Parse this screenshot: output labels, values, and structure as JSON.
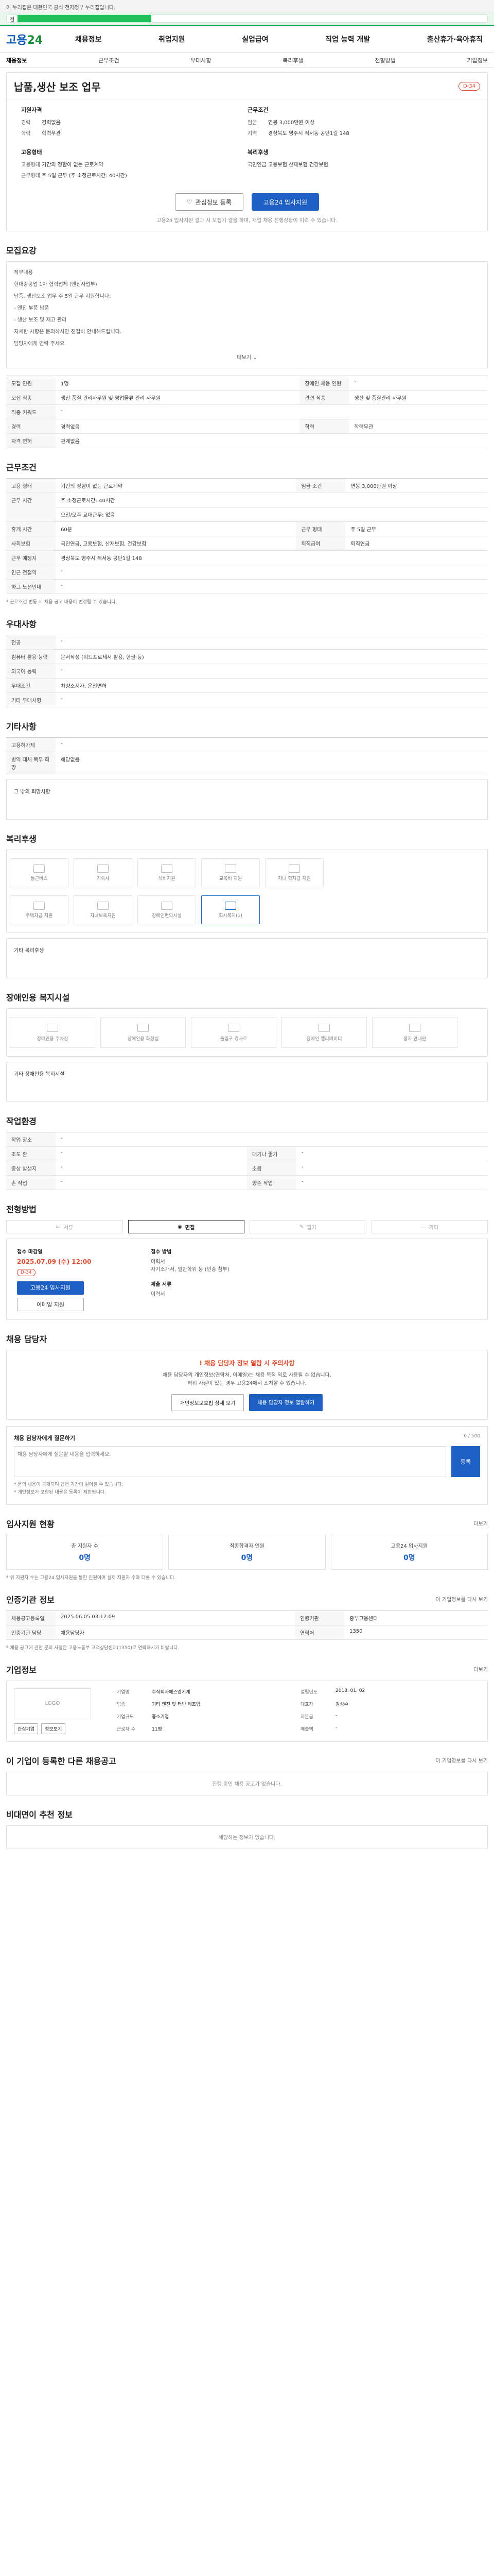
{
  "gov_banner": "이 누리집은 대한민국 공식 전자정부 누리집입니다.",
  "search": {
    "prefix": "검"
  },
  "header": {
    "logo_main": "고용",
    "logo_sub": "24",
    "nav": [
      "채용정보",
      "취업지원",
      "실업급여",
      "직업 능력 개발",
      "출산휴가·육아휴직"
    ]
  },
  "subnav": [
    "채용정보",
    "근무조건",
    "우대사항",
    "복리후생",
    "전형방법",
    "기업정보"
  ],
  "job": {
    "title": "납품,생산 보조 업무",
    "dday": "D-34",
    "recruit_heading": "지원자격",
    "recruit": [
      {
        "k": "경력",
        "v": "경력없음"
      },
      {
        "k": "학력",
        "v": "학력무관"
      }
    ],
    "employ_heading": "고용형태",
    "employ": [
      {
        "k": "고용형태",
        "v": "기간의 정함이 없는 근로계약"
      },
      {
        "k": "근무형태",
        "v": "주 5일 근무 (주 소정근로시간: 40시간)"
      }
    ],
    "cond_heading": "근무조건",
    "cond": [
      {
        "k": "임금",
        "v": "연봉 3,000만원 이상"
      },
      {
        "k": "지역",
        "v": "경상북도 영주시 적서동 공단1길 148"
      }
    ],
    "cond2_heading": "복리후생",
    "cond2": [
      {
        "k": "",
        "v": "국민연금 고용보험 산재보험 건강보험"
      }
    ]
  },
  "actions": {
    "scrap": "관심정보 등록",
    "apply": "고용24 입사지원"
  },
  "actions_note": "고용24 입사지원 결과 시 모집기 결을 하며, 개업 채용 진행상황이 이력 수 있습니다.",
  "duty": {
    "title": "모집요강",
    "lines": [
      "직무내용",
      "현대중공업 1차 협력업체 (엔진사업부)",
      "납품, 생산보조 업무 주 5일 근무 지원합니다.",
      "- 엔진 부품 납품",
      "- 생산 보조 및 재고 관리",
      "자세한 사항은 문의하시면 친절히 안내해드립니다.",
      "담당자에게 연락 주세요."
    ],
    "more": "더보기"
  },
  "recruit_table": [
    [
      "모집 인원",
      "1명",
      "장애인 채용 인원",
      "-"
    ],
    [
      "모집 직종",
      "생산 품질 관리사무원 및 영업물류 관리 사무원",
      "관련 직종",
      "생산 및 품질관리 사무원"
    ],
    [
      "직종 키워드",
      "-",
      "",
      ""
    ],
    [
      "경력",
      "경력없음",
      "학력",
      "학력무관"
    ],
    [
      "자격 면허",
      "관계없음",
      "",
      ""
    ]
  ],
  "work": {
    "title": "근무조건",
    "rows": [
      [
        "고용 형태",
        "기간의 정함이 없는 근로계약",
        "임금 조건",
        "연봉 3,000만원 이상"
      ],
      [
        "근무 시간",
        "주 소정근로시간: 40시간",
        "",
        ""
      ],
      [
        "",
        "오전/오후 교대근무: 없음",
        "",
        ""
      ],
      [
        "휴게 시간",
        "60분",
        "근무 형태",
        "주 5일 근무"
      ],
      [
        "사회보험",
        "국민연금, 고용보험, 산재보험, 건강보험",
        "퇴직급여",
        "퇴직연금"
      ],
      [
        "근무 예정지",
        "경상북도 영주시 적서동 공단1길 148",
        "",
        ""
      ],
      [
        "인근 전철역",
        "-",
        "",
        ""
      ],
      [
        "하그 노선안내",
        "-",
        "",
        ""
      ]
    ],
    "footnote": "* 근로조건 변동 시 채용 공고 내용이 변경될 수 있습니다."
  },
  "pref": {
    "title": "우대사항",
    "rows": [
      [
        "전공",
        "-"
      ],
      [
        "컴퓨터 활용 능력",
        "문서작성 (워드프로세서 활용, 한글 등)"
      ],
      [
        "외국어 능력",
        "-"
      ],
      [
        "우대조건",
        "차량소지자, 운전면허"
      ],
      [
        "기타 우대사항",
        "-"
      ]
    ]
  },
  "other": {
    "title": "기타사항",
    "rows": [
      [
        "고용허가제",
        "-"
      ],
      [
        "병역 대체 복무 희망",
        "해당없음"
      ]
    ],
    "note": "그 밖의 희망사항"
  },
  "welfare": {
    "title": "복리후생",
    "items": [
      "통근버스",
      "기숙사",
      "식비지원",
      "교육비 지원",
      "자녀 학자금 지원",
      "주택자금 지원",
      "자녀보육지원",
      "장애인편의시설",
      "회사복지(1)",
      ""
    ],
    "note": "기타 복리후생"
  },
  "facility": {
    "title": "장애인용 복지시설",
    "items": [
      "장애인용 주차장",
      "장애인용 화장실",
      "출입구 경사로",
      "장애인 엘리베이터",
      "점자 안내판"
    ],
    "note": "기타 장애인용 복지시설"
  },
  "process": {
    "title": "작업환경",
    "rows": [
      [
        "작업 장소",
        "-",
        "",
        ""
      ],
      [
        "조도 환",
        "-",
        "대기나 좋기",
        "-"
      ],
      [
        "중상 발생지",
        "-",
        "소음",
        "-"
      ],
      [
        "손 작업",
        "-",
        "양손 작업",
        "-"
      ]
    ]
  },
  "method": {
    "title": "전형방법",
    "items": [
      "서류",
      "면접",
      "필기",
      "기타"
    ],
    "deadline_label": "접수 마감일",
    "deadline": "2025.07.09 (수) 12:00",
    "dday": "D-34",
    "apply_btn": "고용24 입사지원",
    "email_btn": "이메일 지원",
    "docs_label": "접수 방법",
    "docs": [
      "이력서",
      "자기소개서, 일반학위 등 (인증 첨부)"
    ],
    "submit_label": "제출 서류",
    "submit": "이력서"
  },
  "contact": {
    "title": "채용 담당자",
    "warn": "채용 담당자 정보 열람 시 주의사항",
    "lines": [
      "채용 담당자의 개인정보(연락처, 이메일)는 채용 목적 외로 사용될 수 없습니다.",
      "허위 사실이 있는 경우 고용24에서 조치할 수 있습니다."
    ],
    "btn1": "개인정보보호법 상세 보기",
    "btn2": "채용 담당자 정보 열람하기"
  },
  "qa": {
    "title": "채용 담당자에게 질문하기",
    "count": "0 / 500",
    "placeholder": "채용 담당자에게 질문할 내용을 입력하세요.",
    "button": "등록",
    "notes": [
      "* 문의 내용이 공개되며 답변 기간이 길어질 수 있습니다.",
      "* 개인정보가 포함된 내용은 등록이 제한됩니다."
    ]
  },
  "applicant": {
    "title": "입사지원 현황",
    "more": "더보기",
    "stats": [
      {
        "label": "총 지원자 수",
        "value": "0명"
      },
      {
        "label": "최종합격자 인원",
        "value": "0명"
      },
      {
        "label": "고용24 입사지원",
        "value": "0명"
      }
    ],
    "note": "* 위 지원자 수는 고용24 입사지원을 통한 인원이며 실제 지원자 수와 다를 수 있습니다."
  },
  "agency_info": {
    "title": "인증기관 정보",
    "more": "이 기업정보를 다시 보기",
    "rows": [
      [
        "채용공고등록일",
        "2025.06.05 03:12:09",
        "인증기관",
        "중부고용센터"
      ],
      [
        "인증기관 담당",
        "채용담당자",
        "연락처",
        "1350"
      ]
    ],
    "note": "* 채용 공고에 관한 문의 사항은 고용노동부 고객상담센터(1350)로 연락하시기 바랍니다."
  },
  "company": {
    "title": "기업정보",
    "more": "더보기",
    "logo_text": "LOGO",
    "btns": [
      "관심기업",
      "정보보기"
    ],
    "info": [
      [
        "기업명",
        "주식회사에스엠기계"
      ],
      [
        "업종",
        "기타 엔진 및 터빈 제조업"
      ],
      [
        "기업규모",
        "중소기업"
      ],
      [
        "근로자 수",
        "11명"
      ],
      [
        "설립년도",
        "2018. 01. 02"
      ],
      [
        "대표자",
        "김성수"
      ],
      [
        "자본금",
        "-"
      ],
      [
        "매출액",
        "-"
      ]
    ]
  },
  "same_company": {
    "title": "이 기업이 등록한 다른 채용공고",
    "more": "이 기업정보를 다시 보기",
    "empty": "진행 중인 채용 공고가 없습니다."
  },
  "recommend": {
    "title": "비대면이 추천 정보",
    "empty": "해당하는 정보가 없습니다."
  }
}
